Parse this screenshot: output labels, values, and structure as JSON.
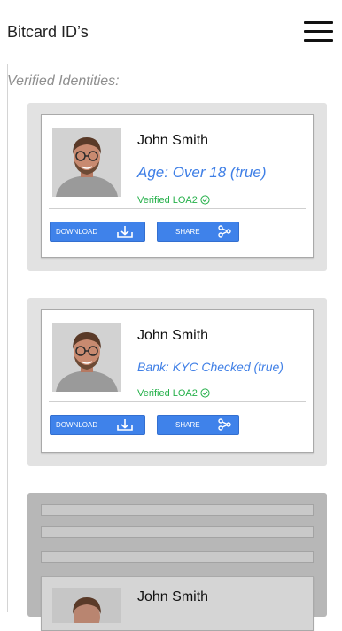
{
  "header": {
    "title": "Bitcard ID’s",
    "menu_icon": "hamburger-menu-icon"
  },
  "section": {
    "label": "Verified Identities:"
  },
  "colors": {
    "link_blue": "#3f7fe6",
    "verified_green": "#25b04a",
    "button_blue": "#3f82ea"
  },
  "identities": [
    {
      "name": "John Smith",
      "claim": "Age: Over 18 (true)",
      "verified": "Verified LOA2",
      "download_label": "DOWNLOAD",
      "share_label": "SHARE"
    },
    {
      "name": "John Smith",
      "claim": "Bank: KYC Checked (true)",
      "verified": "Verified LOA2",
      "download_label": "DOWNLOAD",
      "share_label": "SHARE"
    },
    {
      "name": "John Smith"
    }
  ]
}
